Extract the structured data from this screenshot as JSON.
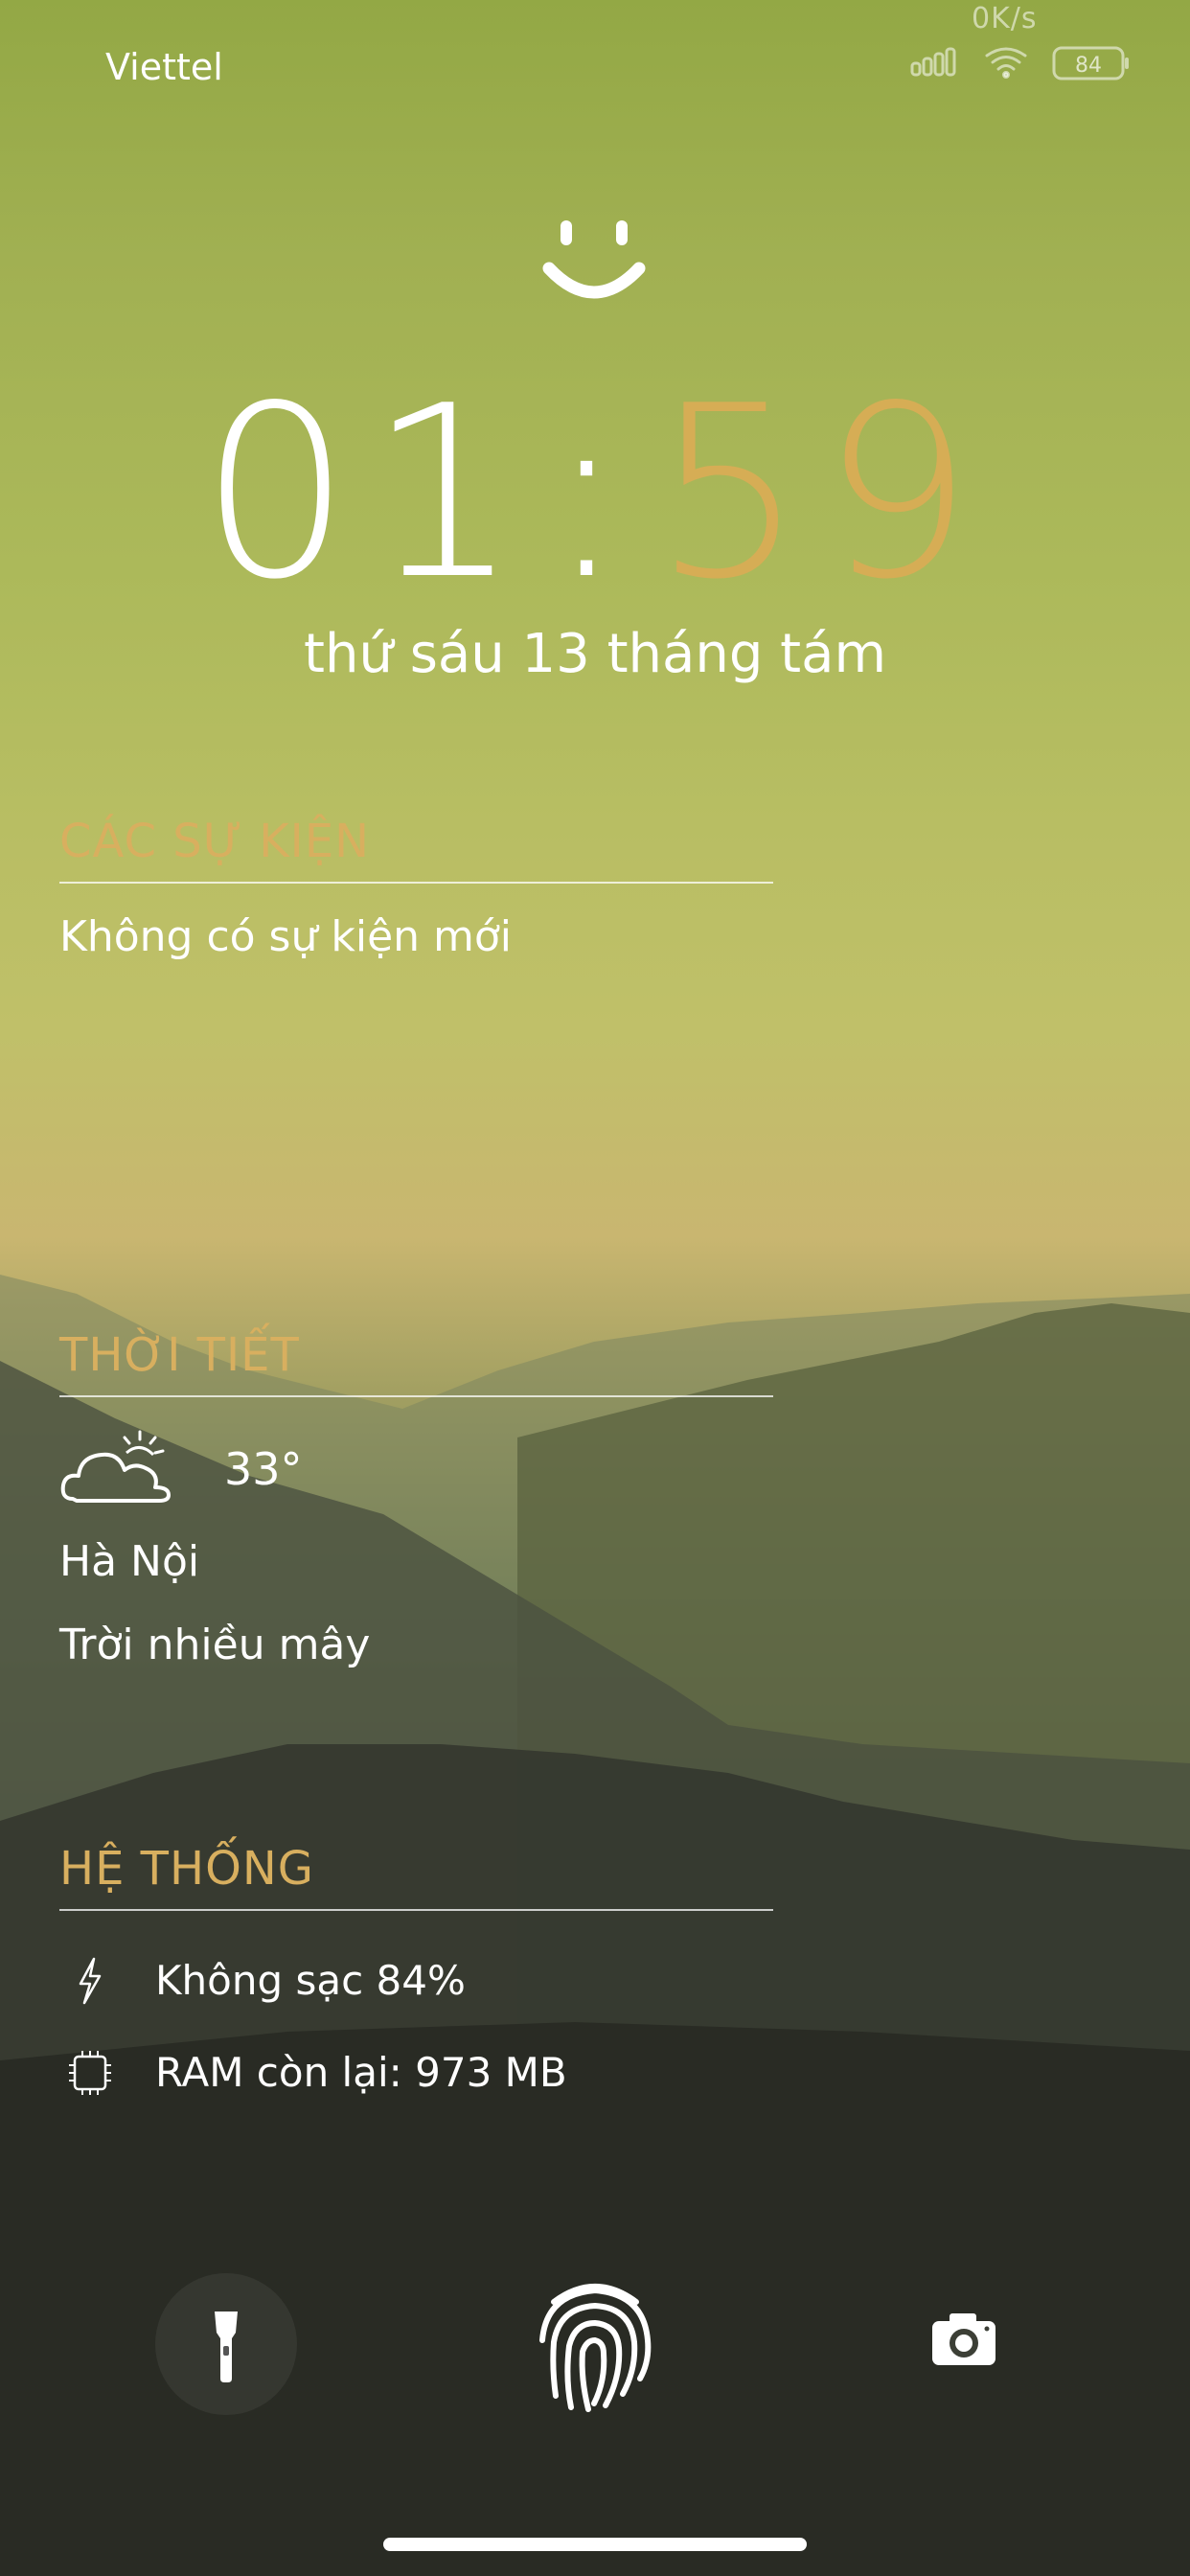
{
  "status_bar": {
    "carrier": "Viettel",
    "network_speed": "0K/s",
    "battery_level": "84",
    "icons": [
      "signal-icon",
      "wifi-icon",
      "battery-icon"
    ]
  },
  "lockscreen": {
    "clock": {
      "hours": "01",
      "separator": ":",
      "minutes": "59"
    },
    "date": "thứ sáu 13 tháng tám",
    "events": {
      "title": "CÁC SỰ KIỆN",
      "text": "Không có sự kiện mới"
    },
    "weather": {
      "title": "THỜI TIẾT",
      "temperature": "33°",
      "city": "Hà Nội",
      "condition": "Trời nhiều mây"
    },
    "system": {
      "title": "HỆ THỐNG",
      "battery_status": "Không sạc 84%",
      "ram_status": "RAM còn lại: 973 MB"
    }
  },
  "colors": {
    "accent": "#d6ad55",
    "text": "#ffffff"
  },
  "bottom_actions": [
    "flashlight-icon",
    "fingerprint-icon",
    "camera-icon"
  ]
}
